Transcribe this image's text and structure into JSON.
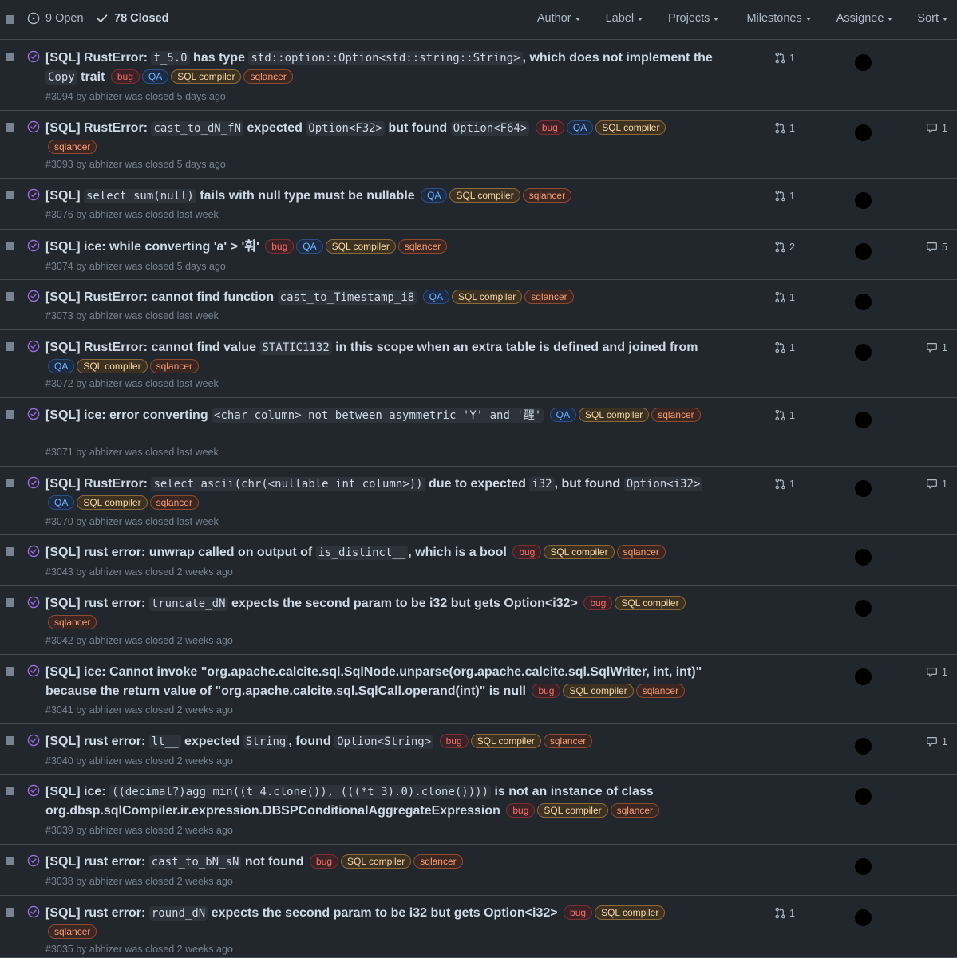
{
  "header": {
    "open_label": "9 Open",
    "closed_label": "78 Closed",
    "filters": [
      "Author",
      "Label",
      "Projects",
      "Milestones",
      "Assignee",
      "Sort"
    ]
  },
  "labels": {
    "bug": "bug",
    "qa": "QA",
    "sql_compiler": "SQL compiler",
    "sqlancer": "sqlancer"
  },
  "issues": [
    {
      "title": [
        {
          "t": "[SQL] RustError: "
        },
        {
          "c": "t_5.0"
        },
        {
          "t": " has type "
        },
        {
          "c": "std::option::Option<std::string::String>"
        },
        {
          "t": ", which does not implement the "
        },
        {
          "c": "Copy"
        },
        {
          "t": " trait"
        }
      ],
      "labels": [
        "bug",
        "qa",
        "sql_compiler",
        "sqlancer"
      ],
      "meta": "#3094 by abhizer was closed 5 days ago",
      "prs": "1",
      "comments": null
    },
    {
      "title": [
        {
          "t": "[SQL] RustError: "
        },
        {
          "c": "cast_to_dN_fN"
        },
        {
          "t": " expected "
        },
        {
          "c": "Option<F32>"
        },
        {
          "t": " but found "
        },
        {
          "c": "Option<F64>"
        }
      ],
      "labels": [
        "bug",
        "qa",
        "sql_compiler",
        "sqlancer"
      ],
      "meta": "#3093 by abhizer was closed 5 days ago",
      "prs": "1",
      "comments": "1"
    },
    {
      "title": [
        {
          "t": "[SQL] "
        },
        {
          "c": "select sum(null)"
        },
        {
          "t": " fails with null type must be nullable"
        }
      ],
      "labels": [
        "qa",
        "sql_compiler",
        "sqlancer"
      ],
      "meta": "#3076 by abhizer was closed last week",
      "prs": "1",
      "comments": null
    },
    {
      "title": [
        {
          "t": "[SQL] ice: while converting 'a' > '훠'"
        }
      ],
      "labels": [
        "bug",
        "qa",
        "sql_compiler",
        "sqlancer"
      ],
      "meta": "#3074 by abhizer was closed 5 days ago",
      "prs": "2",
      "comments": "5"
    },
    {
      "title": [
        {
          "t": "[SQL] RustError: cannot find function "
        },
        {
          "c": "cast_to_Timestamp_i8"
        }
      ],
      "labels": [
        "qa",
        "sql_compiler",
        "sqlancer"
      ],
      "meta": "#3073 by abhizer was closed last week",
      "prs": "1",
      "comments": null
    },
    {
      "title": [
        {
          "t": "[SQL] RustError: cannot find value "
        },
        {
          "c": "STATIC1132"
        },
        {
          "t": " in this scope when an extra table is defined and joined from"
        }
      ],
      "labels": [
        "qa",
        "sql_compiler",
        "sqlancer"
      ],
      "meta": "#3072 by abhizer was closed last week",
      "prs": "1",
      "comments": "1"
    },
    {
      "title": [
        {
          "t": "[SQL] ice: error converting "
        },
        {
          "c": "<char column> not between asymmetric 'Y' and '醒'"
        }
      ],
      "labels": [
        "qa",
        "sql_compiler",
        "sqlancer"
      ],
      "meta": "#3071 by abhizer was closed last week",
      "prs": "1",
      "comments": null
    },
    {
      "title": [
        {
          "t": "[SQL] RustError: "
        },
        {
          "c": "select ascii(chr(<nullable int column>))"
        },
        {
          "t": " due to expected "
        },
        {
          "c": "i32"
        },
        {
          "t": ", but found "
        },
        {
          "c": "Option<i32>"
        }
      ],
      "labels": [
        "qa",
        "sql_compiler",
        "sqlancer"
      ],
      "meta": "#3070 by abhizer was closed last week",
      "prs": "1",
      "comments": "1"
    },
    {
      "title": [
        {
          "t": "[SQL] rust error: unwrap called on output of "
        },
        {
          "c": "is_distinct__"
        },
        {
          "t": ", which is a bool"
        }
      ],
      "labels": [
        "bug",
        "sql_compiler",
        "sqlancer"
      ],
      "meta": "#3043 by abhizer was closed 2 weeks ago",
      "prs": null,
      "comments": null
    },
    {
      "title": [
        {
          "t": "[SQL] rust error: "
        },
        {
          "c": "truncate_dN"
        },
        {
          "t": " expects the second param to be i32 but gets Option<i32>"
        }
      ],
      "labels": [
        "bug",
        "sql_compiler",
        "sqlancer"
      ],
      "meta": "#3042 by abhizer was closed 2 weeks ago",
      "prs": null,
      "comments": null
    },
    {
      "title": [
        {
          "t": "[SQL] ice: Cannot invoke \"org.apache.calcite.sql.SqlNode.unparse(org.apache.calcite.sql.SqlWriter, int, int)\" because the return value of \"org.apache.calcite.sql.SqlCall.operand(int)\" is null"
        }
      ],
      "labels": [
        "bug",
        "sql_compiler",
        "sqlancer"
      ],
      "meta": "#3041 by abhizer was closed 2 weeks ago",
      "prs": null,
      "comments": "1"
    },
    {
      "title": [
        {
          "t": "[SQL] rust error: "
        },
        {
          "c": "lt__"
        },
        {
          "t": " expected "
        },
        {
          "c": "String"
        },
        {
          "t": ", found "
        },
        {
          "c": "Option<String>"
        }
      ],
      "labels": [
        "bug",
        "sql_compiler",
        "sqlancer"
      ],
      "meta": "#3040 by abhizer was closed 2 weeks ago",
      "prs": null,
      "comments": "1"
    },
    {
      "title": [
        {
          "t": "[SQL] ice: "
        },
        {
          "c": "((decimal?)agg_min((t_4.clone()), (((*t_3).0).clone())))"
        },
        {
          "t": " is not an instance of class org.dbsp.sqlCompiler.ir.expression.DBSPConditionalAggregateExpression"
        }
      ],
      "labels": [
        "bug",
        "sql_compiler",
        "sqlancer"
      ],
      "meta": "#3039 by abhizer was closed 2 weeks ago",
      "prs": null,
      "comments": null
    },
    {
      "title": [
        {
          "t": "[SQL] rust error: "
        },
        {
          "c": "cast_to_bN_sN"
        },
        {
          "t": " not found"
        }
      ],
      "labels": [
        "bug",
        "sql_compiler",
        "sqlancer"
      ],
      "meta": "#3038 by abhizer was closed 2 weeks ago",
      "prs": null,
      "comments": null
    },
    {
      "title": [
        {
          "t": "[SQL] rust error: "
        },
        {
          "c": "round_dN"
        },
        {
          "t": " expects the second param to be i32 but gets Option<i32>"
        }
      ],
      "labels": [
        "bug",
        "sql_compiler",
        "sqlancer"
      ],
      "meta": "#3035 by abhizer was closed 2 weeks ago",
      "prs": "1",
      "comments": null
    }
  ]
}
